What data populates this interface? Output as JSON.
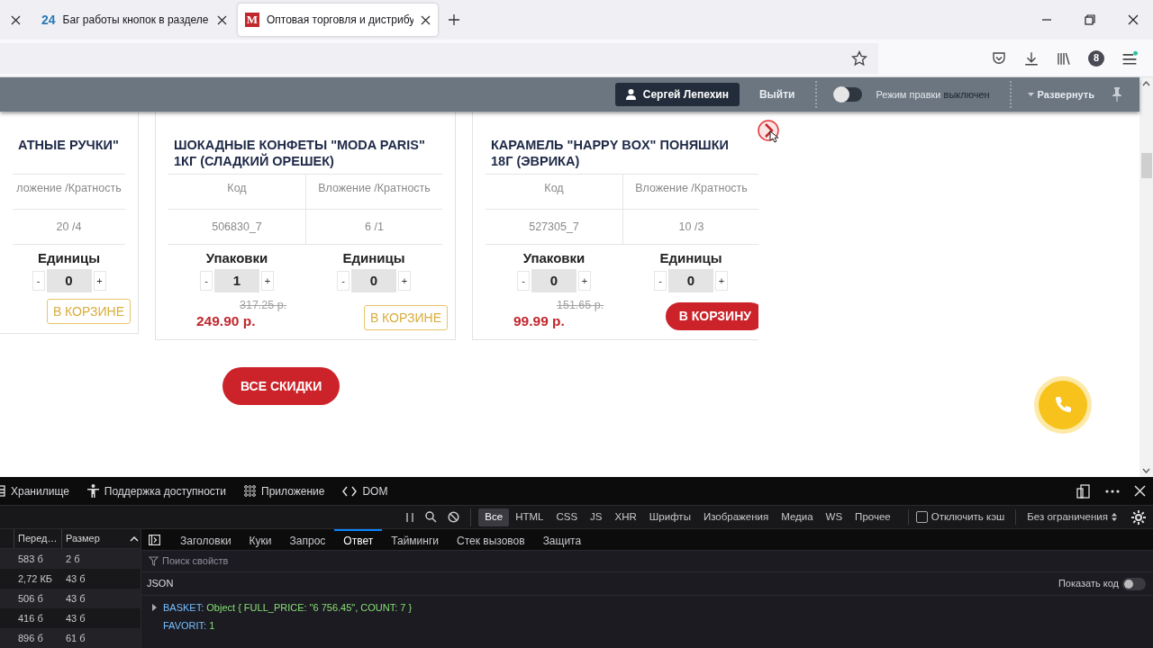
{
  "browser": {
    "tabs": [
      {
        "selected": false
      },
      {
        "favicon_text": "24",
        "title": "Баг работы кнопок в разделе",
        "selected": false
      },
      {
        "favicon_text": "M",
        "title": "Оптовая торговля и дистрибу",
        "selected": true
      }
    ],
    "toolbar_badge": "8"
  },
  "admin_bar": {
    "user": "Сергей Лепехин",
    "logout": "Выйти",
    "edit_mode": {
      "label": "Режим правки",
      "state_text": "выключен",
      "on": false
    },
    "expand": "Развернуть"
  },
  "products": [
    {
      "title": "АТНЫЕ РУЧКИ\"",
      "columns": [
        {
          "label": "ложение /Кратность",
          "value": "20 /4"
        }
      ],
      "quantities": [
        {
          "label": "Единицы",
          "value": "0",
          "minus": "-",
          "plus": "+"
        }
      ],
      "button": {
        "label": "В КОРЗИНЕ",
        "kind": "in_cart"
      }
    },
    {
      "title": "ШОКАДНЫЕ КОНФЕТЫ \"MODA PARIS\" 1КГ (СЛАДКИЙ ОРЕШЕК)",
      "columns": [
        {
          "label": "Код",
          "value": "506830_7"
        },
        {
          "label": "Вложение /Кратность",
          "value": "6 /1"
        }
      ],
      "quantities": [
        {
          "label": "Упаковки",
          "value": "1",
          "minus": "-",
          "plus": "+"
        },
        {
          "label": "Единицы",
          "value": "0",
          "minus": "-",
          "plus": "+"
        }
      ],
      "old_price": "317.25 р.",
      "price": "249.90 р.",
      "button": {
        "label": "В КОРЗИНЕ",
        "kind": "in_cart"
      }
    },
    {
      "title": "КАРАМЕЛЬ \"HAPPY BOX\" ПОНЯШКИ 18Г (ЭВРИКА)",
      "columns": [
        {
          "label": "Код",
          "value": "527305_7"
        },
        {
          "label": "Вложение /Кратность",
          "value": "10 /3"
        }
      ],
      "quantities": [
        {
          "label": "Упаковки",
          "value": "0",
          "minus": "-",
          "plus": "+"
        },
        {
          "label": "Единицы",
          "value": "0",
          "minus": "-",
          "plus": "+"
        }
      ],
      "old_price": "151.65 р.",
      "price": "99.99 р.",
      "button": {
        "label": "В КОРЗИНУ",
        "kind": "add"
      }
    }
  ],
  "all_discounts_button": "ВСЕ СКИДКИ",
  "devtools": {
    "panels": [
      {
        "label": "Хранилище",
        "kind": "storage"
      },
      {
        "label": "Поддержка доступности",
        "kind": "accessibility"
      },
      {
        "label": "Приложение",
        "kind": "application"
      },
      {
        "label": "DOM",
        "kind": "dom"
      }
    ],
    "filters": [
      {
        "label": "Все",
        "selected": true
      },
      {
        "label": "HTML",
        "selected": false
      },
      {
        "label": "CSS",
        "selected": false
      },
      {
        "label": "JS",
        "selected": false
      },
      {
        "label": "XHR",
        "selected": false
      },
      {
        "label": "Шрифты",
        "selected": false
      },
      {
        "label": "Изображения",
        "selected": false
      },
      {
        "label": "Медиа",
        "selected": false
      },
      {
        "label": "WS",
        "selected": false
      },
      {
        "label": "Прочее",
        "selected": false
      }
    ],
    "disable_cache": {
      "label": "Отключить кэш",
      "checked": false
    },
    "throttling": "Без ограничения",
    "requests": {
      "columns": [
        "Перед…",
        "Размер"
      ],
      "rows": [
        [
          "583 б",
          "2 б"
        ],
        [
          "2,72 КБ",
          "43 б"
        ],
        [
          "506 б",
          "43 б"
        ],
        [
          "416 б",
          "43 б"
        ],
        [
          "896 б",
          "61 б"
        ]
      ]
    },
    "detail_tabs": [
      {
        "label": "Заголовки",
        "selected": false
      },
      {
        "label": "Куки",
        "selected": false
      },
      {
        "label": "Запрос",
        "selected": false
      },
      {
        "label": "Ответ",
        "selected": true
      },
      {
        "label": "Тайминги",
        "selected": false
      },
      {
        "label": "Стек вызовов",
        "selected": false
      },
      {
        "label": "Защита",
        "selected": false
      }
    ],
    "filter_placeholder": "Поиск свойств",
    "format_label": "JSON",
    "show_code": {
      "label": "Показать код",
      "on": false
    },
    "tree": [
      {
        "key": "BASKET:",
        "value": "Object { FULL_PRICE: \"6 756.45\", COUNT: 7 }",
        "expanded": false
      },
      {
        "key": "FAVORIT:",
        "value": "1"
      }
    ]
  }
}
